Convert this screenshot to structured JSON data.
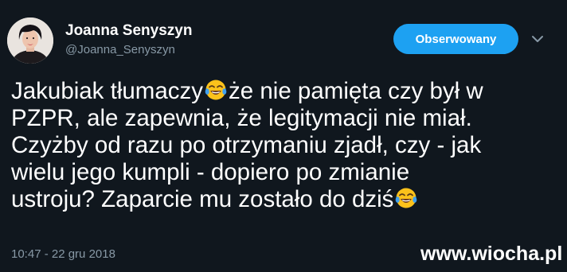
{
  "author": {
    "name": "Joanna Senyszyn",
    "handle": "@Joanna_Senyszyn"
  },
  "follow_button": {
    "label": "Obserwowany"
  },
  "caret_icon": "chevron-down-icon",
  "tweet": {
    "lines": [
      {
        "before": "Jakubiak tłumaczy",
        "emoji": "tears-of-joy",
        "after": "że nie pamięta czy był w"
      },
      {
        "text": "PZPR, ale zapewnia, że legitymacji nie miał."
      },
      {
        "text": "Czyżby od razu po otrzymaniu zjadł, czy - jak"
      },
      {
        "text": "wielu jego kumpli - dopiero po zmianie"
      },
      {
        "before": "ustroju? Zaparcie mu zostało do dziś",
        "emoji": "tears-of-joy"
      }
    ],
    "timestamp": "10:47 - 22 gru 2018"
  },
  "watermark": "www.wiocha.pl",
  "colors": {
    "background": "#10171e",
    "accent": "#1da1f2",
    "muted_text": "#8899a6"
  }
}
